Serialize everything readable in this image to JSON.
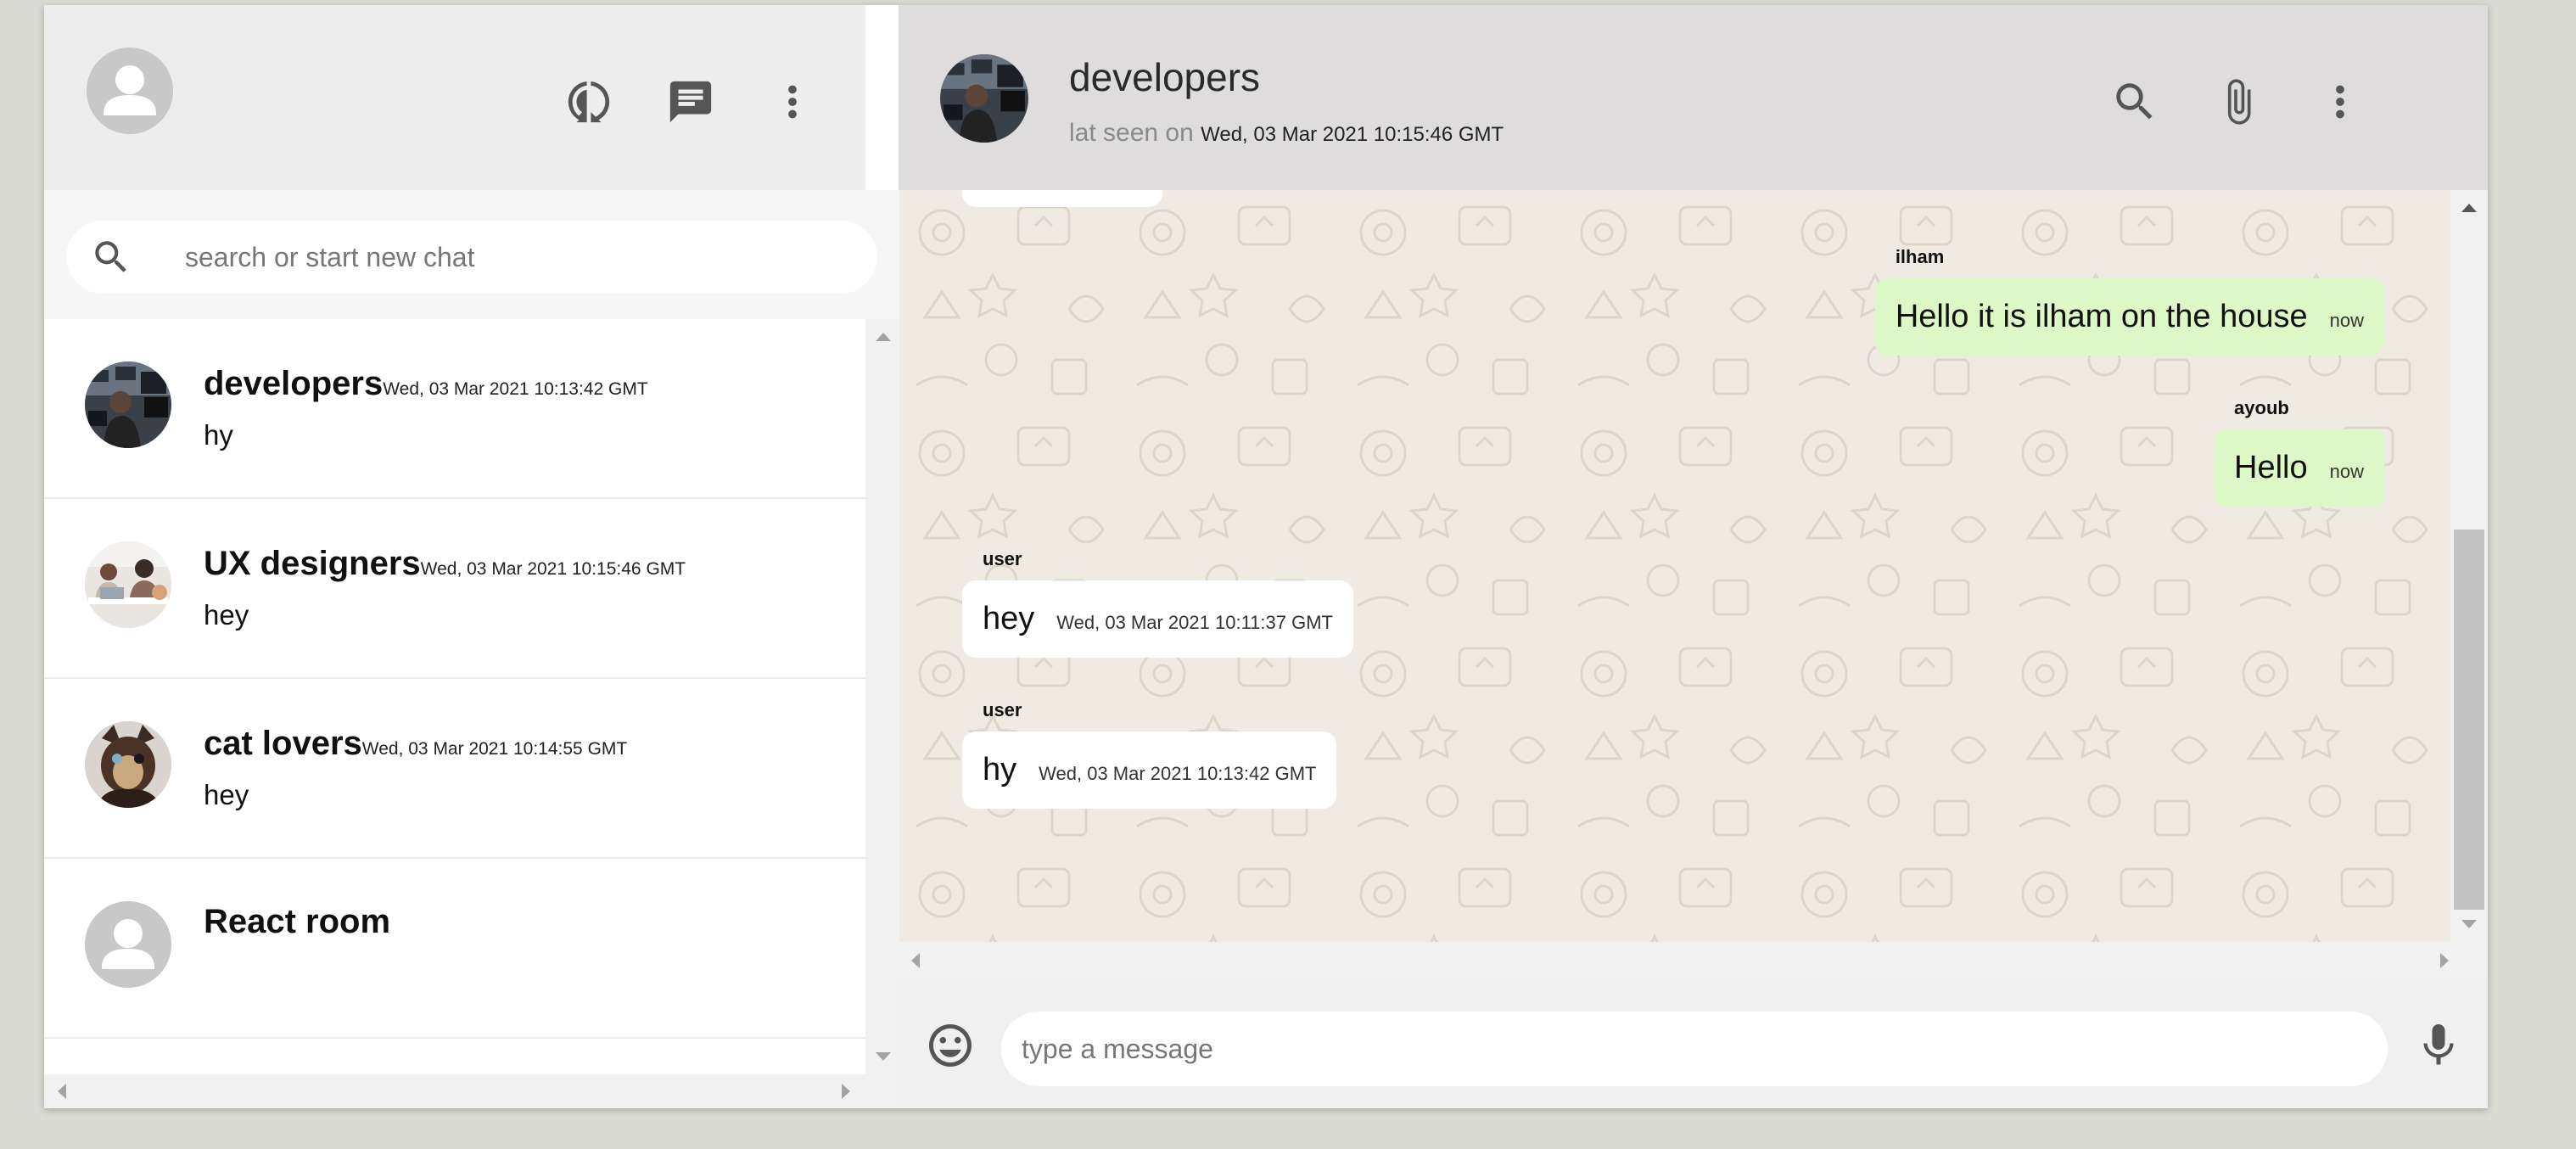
{
  "sidebar": {
    "search": {
      "placeholder": "search or start new chat"
    },
    "icons": {
      "status": "status-icon",
      "chat": "chat-icon",
      "menu": "more-vert-icon"
    },
    "chats": [
      {
        "name": "developers",
        "time": "Wed, 03 Mar 2021 10:13:42 GMT",
        "last_message": "hy",
        "avatar": "office-photo"
      },
      {
        "name": "UX designers",
        "time": "Wed, 03 Mar 2021 10:15:46 GMT",
        "last_message": "hey",
        "avatar": "meeting-photo"
      },
      {
        "name": "cat lovers",
        "time": "Wed, 03 Mar 2021 10:14:55 GMT",
        "last_message": "hey",
        "avatar": "cat-photo"
      },
      {
        "name": "React room",
        "time": "",
        "last_message": "",
        "avatar": "default-avatar"
      }
    ]
  },
  "chat": {
    "room_name": "developers",
    "last_seen_label": "lat seen on",
    "last_seen_time": "Wed, 03 Mar 2021 10:15:46 GMT",
    "icons": {
      "search": "search-icon",
      "attach": "attach-icon",
      "menu": "more-vert-icon"
    },
    "messages": [
      {
        "sender": "ilham",
        "text": "Hello it is ilham on the house",
        "time": "now",
        "mine": true
      },
      {
        "sender": "ayoub",
        "text": "Hello",
        "time": "now",
        "mine": true
      },
      {
        "sender": "user",
        "text": "hey",
        "time": "Wed, 03 Mar 2021 10:11:37 GMT",
        "mine": false
      },
      {
        "sender": "user",
        "text": "hy",
        "time": "Wed, 03 Mar 2021 10:13:42 GMT",
        "mine": false
      }
    ],
    "composer": {
      "placeholder": "type a message"
    }
  },
  "colors": {
    "sent_bubble": "#dcf8c6",
    "received_bubble": "#ffffff",
    "header_bg": "#ededed",
    "chat_bg": "#efeae2"
  }
}
